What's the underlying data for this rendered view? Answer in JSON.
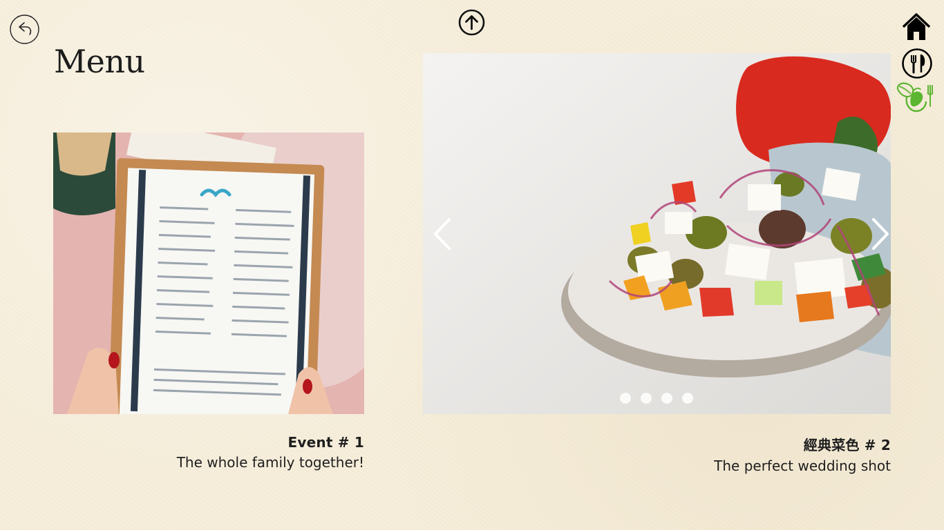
{
  "page": {
    "title": "Menu"
  },
  "nav": {
    "back": "back-arrow-icon",
    "up": "arrow-up-circle-icon",
    "home": "home-icon",
    "menu": "fork-knife-icon",
    "vegan": "leaf-fork-icon"
  },
  "gallery": [
    {
      "title": "Event # 1",
      "subtitle": "The whole family together!",
      "image": "menu-board-photo"
    },
    {
      "title": "經典菜色 # 2",
      "subtitle": "The perfect wedding shot",
      "image": "greek-salad-photo"
    }
  ],
  "carousel": {
    "dots": 4
  },
  "colors": {
    "background": "#f6eedb",
    "accent_green": "#5cb531",
    "text": "#1e1e1e"
  }
}
